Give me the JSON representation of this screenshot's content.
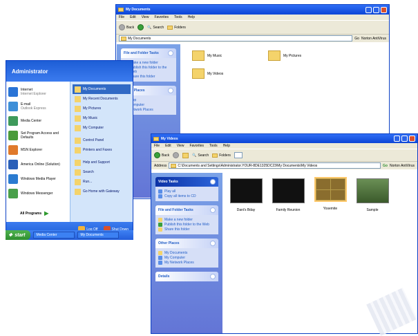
{
  "back_window": {
    "title": "My Documents",
    "menus": [
      "File",
      "Edit",
      "View",
      "Favorites",
      "Tools",
      "Help"
    ],
    "toolbar": {
      "back": "Back",
      "search": "Search",
      "folders": "Folders"
    },
    "address": "My Documents",
    "go": "Go",
    "links": "Norton AntiVirus",
    "panels": [
      {
        "title": "File and Folder Tasks",
        "items": [
          "Make a new folder",
          "Publish this folder to the Web",
          "Share this folder"
        ]
      },
      {
        "title": "Other Places",
        "items": [
          "Desktop",
          "My Computer",
          "My Network Places"
        ]
      }
    ],
    "folders": [
      "My Music",
      "My Pictures",
      "My Videos"
    ]
  },
  "start_menu": {
    "user": "Administrator",
    "pinned": [
      {
        "label": "Internet",
        "sub": "Internet Explorer",
        "color": "#2a74d6"
      },
      {
        "label": "E-mail",
        "sub": "Outlook Express",
        "color": "#3d8fd8"
      },
      {
        "label": "Media Center",
        "sub": "",
        "color": "#3e9a5b"
      },
      {
        "label": "Set Program Access and Defaults",
        "sub": "",
        "color": "#4a9b3b"
      },
      {
        "label": "MSN Explorer",
        "sub": "",
        "color": "#e07a2b"
      },
      {
        "label": "America Online (Solution)",
        "sub": "",
        "color": "#2a5fb8"
      },
      {
        "label": "Windows Media Player",
        "sub": "",
        "color": "#2b7bd0"
      },
      {
        "label": "Windows Messenger",
        "sub": "",
        "color": "#49a04a"
      }
    ],
    "all_programs": "All Programs",
    "right_items": [
      "My Documents",
      "My Recent Documents",
      "My Pictures",
      "My Music",
      "My Computer",
      "Control Panel",
      "Printers and Faxes",
      "Help and Support",
      "Search",
      "Run...",
      "Go Home with Gateway"
    ],
    "log_off": "Log Off",
    "shut_down": "Shut Down"
  },
  "taskbar": {
    "start": "start",
    "tasks": [
      "Media Center",
      "My Documents"
    ]
  },
  "front_window": {
    "title": "My Videos",
    "menus": [
      "File",
      "Edit",
      "View",
      "Favorites",
      "Tools",
      "Help"
    ],
    "toolbar": {
      "back": "Back",
      "search": "Search",
      "folders": "Folders"
    },
    "address_label": "Address",
    "address": "C:\\Documents and Settings\\Administrator.YOUR-8DE1325DC23\\My Documents\\My Videos",
    "go": "Go",
    "links": "Norton AntiVirus",
    "video_tasks": {
      "title": "Video Tasks",
      "items": [
        "Play all",
        "Copy all items to CD"
      ]
    },
    "file_tasks": {
      "title": "File and Folder Tasks",
      "items": [
        "Make a new folder",
        "Publish this folder to the Web",
        "Share this folder"
      ]
    },
    "other_places": {
      "title": "Other Places",
      "items": [
        "My Documents",
        "My Computer",
        "My Network Places"
      ]
    },
    "details": {
      "title": "Details"
    },
    "videos": [
      "Dani's Bday",
      "Family Reunion",
      "Yosemite",
      "Sample"
    ]
  }
}
